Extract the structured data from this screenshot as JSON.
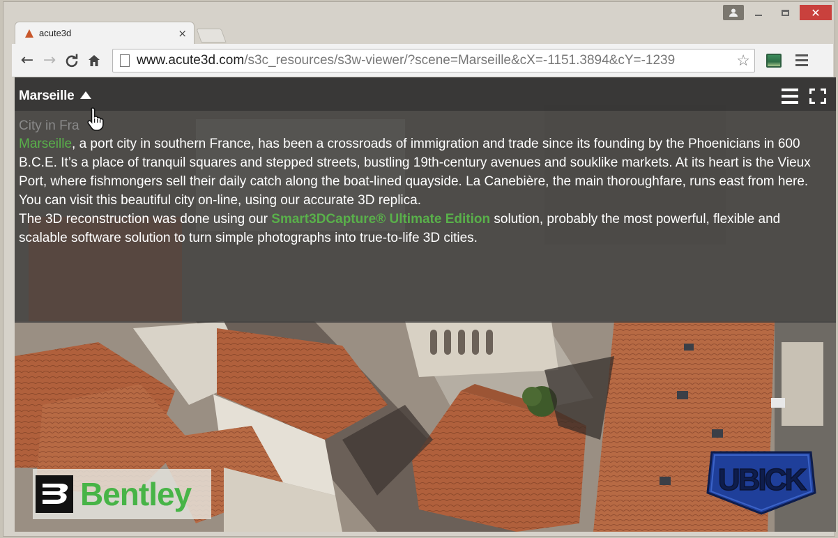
{
  "browser": {
    "tab_title": "acute3d",
    "tab_close": "×",
    "url_host": "www.acute3d.com",
    "url_rest": "/s3c_resources/s3w-viewer/?scene=Marseille&cX=-1151.3894&cY=-1239",
    "back_icon": "←",
    "forward_icon": "→",
    "reload_icon": "C",
    "home_icon": "⌂",
    "star_icon": "☆"
  },
  "viewer": {
    "scene_name": "Marseille",
    "heading": "City in Fra",
    "paragraph1_link": "Marseille",
    "paragraph1_rest": ", a port city in southern France, has been a crossroads of immigration and trade since its founding by the Phoenicians in 600 B.C.E. It’s a place of tranquil squares and stepped streets, bustling 19th-century avenues and souklike markets. At its heart is the Vieux Port, where fishmongers sell their daily catch along the boat-lined quayside. La Canebière, the main thoroughfare, runs east from here.",
    "paragraph2": "You can visit this beautiful city on-line, using our accurate 3D replica.",
    "paragraph3_before": "The 3D reconstruction was done using our ",
    "paragraph3_link": "Smart3DCapture® Ultimate Edition",
    "paragraph3_after": " solution, probably the most powerful, flexible and scalable software solution to turn simple photographs into true-to-life 3D cities."
  },
  "logos": {
    "bentley": "Bentley",
    "ubick": "UBICK"
  },
  "colors": {
    "link_green": "#59b04a",
    "bentley_green": "#47b447",
    "ubick_blue": "#1f3f9a",
    "close_red": "#c9413d"
  }
}
